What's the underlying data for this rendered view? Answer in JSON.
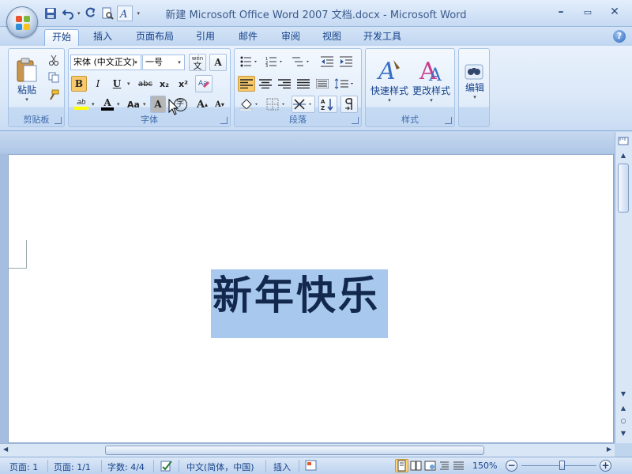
{
  "window": {
    "title": "新建 Microsoft Office Word 2007 文档.docx",
    "separator": " - ",
    "app": "Microsoft Word",
    "controls": {
      "minimize": "–",
      "maximize": "▭",
      "close": "✕"
    }
  },
  "quick_access": {
    "undo_dropdown": "▾",
    "customize": "▾"
  },
  "tabs": [
    "开始",
    "插入",
    "页面布局",
    "引用",
    "邮件",
    "审阅",
    "视图",
    "开发工具"
  ],
  "help": "?",
  "ribbon": {
    "clipboard": {
      "label": "剪贴板",
      "paste": "粘贴",
      "paste_dropdown": "▾"
    },
    "font": {
      "label": "字体",
      "font_name": "宋体 (中文正文)",
      "font_size": "一号",
      "combo_arrow": "▾",
      "pinyin": "wén",
      "pinyin_char": "文",
      "char_border": "A",
      "bold": "B",
      "italic": "I",
      "underline": "U",
      "strikethrough": "abc",
      "subscript": "x₂",
      "superscript": "x²",
      "highlight": "ab",
      "font_color": "A",
      "change_case": "Aa",
      "char_shading": "A",
      "enclose": "字",
      "grow": "A",
      "shrink": "A"
    },
    "paragraph": {
      "label": "段落"
    },
    "styles": {
      "label": "样式",
      "quick_styles": "快速样式",
      "change_styles": "更改样式",
      "quick_styles_dropdown": "▾",
      "change_styles_dropdown": "▾"
    },
    "editing": {
      "label": "编辑",
      "dropdown": "▾"
    }
  },
  "document": {
    "heading": "新年快乐"
  },
  "scrollbar": {
    "up": "▲",
    "down": "▼",
    "prev_page": "▲",
    "next_page": "▼",
    "select_browse": "○",
    "left": "◀",
    "right": "▶"
  },
  "status": {
    "page": "页面: 1",
    "pages": "页面: 1/1",
    "words": "字数: 4/4",
    "language": "中文(简体，中国)",
    "insert_mode": "插入",
    "zoom": "150%",
    "zoom_out": "−",
    "zoom_in": "+"
  },
  "colors": {
    "accent": "#15428b",
    "selection": "#a8c8ee",
    "highlight_yellow": "#ffff00",
    "font_color_red": "#c00000"
  }
}
